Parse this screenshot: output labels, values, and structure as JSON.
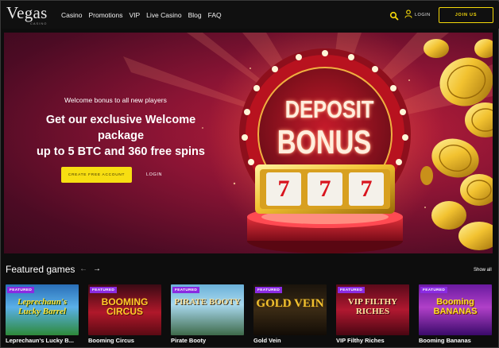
{
  "header": {
    "logo": "Vegas",
    "logo_sub": "CASINO",
    "nav": [
      "Casino",
      "Promotions",
      "VIP",
      "Live Casino",
      "Blog",
      "FAQ"
    ],
    "login_label": "LOGIN",
    "join_label": "JOIN US"
  },
  "hero": {
    "subtitle": "Welcome bonus to all new players",
    "title_line1": "Get our exclusive Welcome package",
    "title_line2": "up to 5 BTC and 360 free spins",
    "cta_label": "CREATE FREE ACCOUNT",
    "login_label": "LOGIN",
    "sign_line1": "DEPOSIT",
    "sign_line2": "BONUS",
    "reels": [
      "7",
      "7",
      "7"
    ]
  },
  "featured": {
    "title": "Featured games",
    "prev_arrow": "←",
    "next_arrow": "→",
    "show_all": "Show all",
    "badge": "FEATURED",
    "games": [
      {
        "name": "Leprechaun's Lucky B...",
        "art": "Leprechaun's Lucky Barrel"
      },
      {
        "name": "Booming Circus",
        "art": "BOOMING CIRCUS"
      },
      {
        "name": "Pirate Booty",
        "art": "PIRATE BOOTY"
      },
      {
        "name": "Gold Vein",
        "art": "GOLD VEIN"
      },
      {
        "name": "VIP Filthy Riches",
        "art": "VIP FILTHY RICHES"
      },
      {
        "name": "Booming Bananas",
        "art": "Booming BANANAS"
      }
    ]
  },
  "colors": {
    "accent": "#f7de12",
    "badge": "#8a2be2",
    "hero_red": "#8a1434"
  },
  "icons": [
    "search-icon",
    "user-icon",
    "coin-icon"
  ]
}
